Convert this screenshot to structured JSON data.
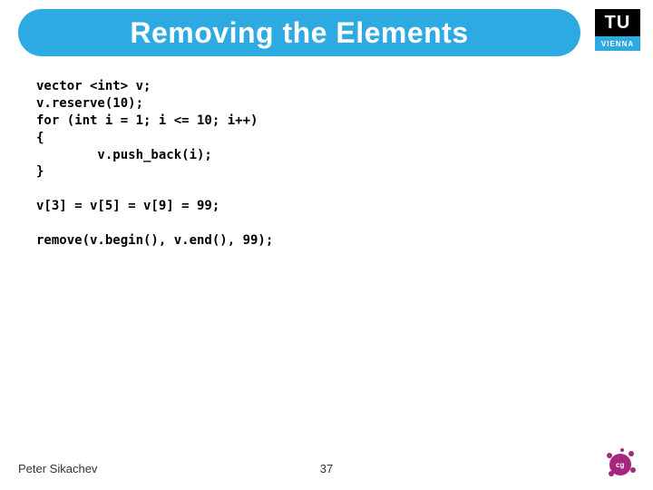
{
  "title": "Removing the Elements",
  "logo": {
    "top": "TU",
    "bottom": "VIENNA"
  },
  "code": {
    "l1": "vector <int> v;",
    "l2": "v.reserve(10);",
    "l3": "for (int i = 1; i <= 10; i++)",
    "l4": "{",
    "l5": "        v.push_back(i);",
    "l6": "}",
    "l7": "",
    "l8": "v[3] = v[5] = v[9] = 99;",
    "l9": "",
    "l10": "remove(v.begin(), v.end(), 99);"
  },
  "footer": {
    "author": "Peter Sikachev",
    "page": "37"
  },
  "inst_logo_label": "cg"
}
